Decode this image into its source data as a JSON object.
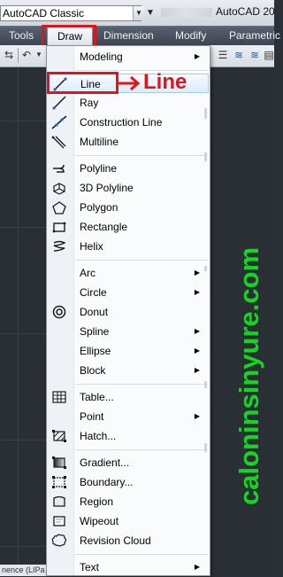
{
  "topbar": {
    "workspace": "AutoCAD Classic",
    "app_title": "AutoCAD 20"
  },
  "menubar": {
    "items": [
      "Tools",
      "Draw",
      "Dimension",
      "Modify",
      "Parametric"
    ],
    "active": "Draw"
  },
  "draw_menu": {
    "items": [
      {
        "label": "Modeling",
        "submenu": true,
        "icon": "none"
      },
      {
        "label": "Line",
        "submenu": false,
        "icon": "line-icon",
        "highlighted": true
      },
      {
        "label": "Ray",
        "submenu": false,
        "icon": "ray-icon"
      },
      {
        "label": "Construction Line",
        "submenu": false,
        "icon": "construction-line-icon"
      },
      {
        "label": "Multiline",
        "submenu": false,
        "icon": "multiline-icon"
      },
      {
        "label": "Polyline",
        "submenu": false,
        "icon": "polyline-icon"
      },
      {
        "label": "3D Polyline",
        "submenu": false,
        "icon": "3d-polyline-icon"
      },
      {
        "label": "Polygon",
        "submenu": false,
        "icon": "polygon-icon"
      },
      {
        "label": "Rectangle",
        "submenu": false,
        "icon": "rectangle-icon"
      },
      {
        "label": "Helix",
        "submenu": false,
        "icon": "helix-icon"
      },
      {
        "label": "Arc",
        "submenu": true,
        "icon": "none"
      },
      {
        "label": "Circle",
        "submenu": true,
        "icon": "none"
      },
      {
        "label": "Donut",
        "submenu": false,
        "icon": "donut-icon"
      },
      {
        "label": "Spline",
        "submenu": true,
        "icon": "none"
      },
      {
        "label": "Ellipse",
        "submenu": true,
        "icon": "none"
      },
      {
        "label": "Block",
        "submenu": true,
        "icon": "none"
      },
      {
        "label": "Table...",
        "submenu": false,
        "icon": "table-icon"
      },
      {
        "label": "Point",
        "submenu": true,
        "icon": "none"
      },
      {
        "label": "Hatch...",
        "submenu": false,
        "icon": "hatch-icon"
      },
      {
        "label": "Gradient...",
        "submenu": false,
        "icon": "gradient-icon"
      },
      {
        "label": "Boundary...",
        "submenu": false,
        "icon": "boundary-icon"
      },
      {
        "label": "Region",
        "submenu": false,
        "icon": "region-icon"
      },
      {
        "label": "Wipeout",
        "submenu": false,
        "icon": "wipeout-icon"
      },
      {
        "label": "Revision Cloud",
        "submenu": false,
        "icon": "revision-cloud-icon"
      },
      {
        "label": "Text",
        "submenu": true,
        "icon": "none"
      }
    ],
    "submenu_arrow": "▶"
  },
  "annotation": {
    "callout": "Line",
    "color": "#e0141b"
  },
  "watermark": {
    "text": "caloninsinyure.com",
    "color": "#14d61f"
  },
  "status_strip": {
    "text": "nence (LIPa"
  }
}
